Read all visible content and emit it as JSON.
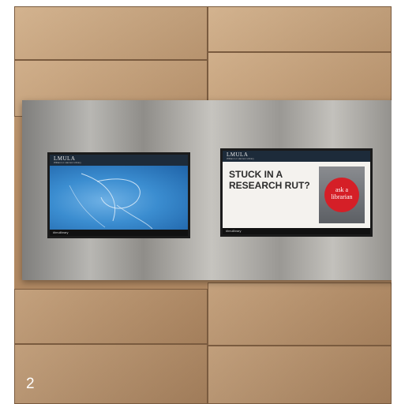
{
  "photo_number": "2",
  "left_screen": {
    "brand": "LMULA",
    "brand_sub": "William H. Hannon Library",
    "tag": "#lmulibrary",
    "background": "#3b8dd0"
  },
  "right_screen": {
    "brand": "LMULA",
    "brand_sub": "William H. Hannon Library",
    "headline_line1": "STUCK IN A",
    "headline_line2": "RESEARCH RUT?",
    "badge_line1": "ask a",
    "badge_line2": "librarian",
    "tag": "#lmulibrary",
    "accent": "#d51f27"
  }
}
